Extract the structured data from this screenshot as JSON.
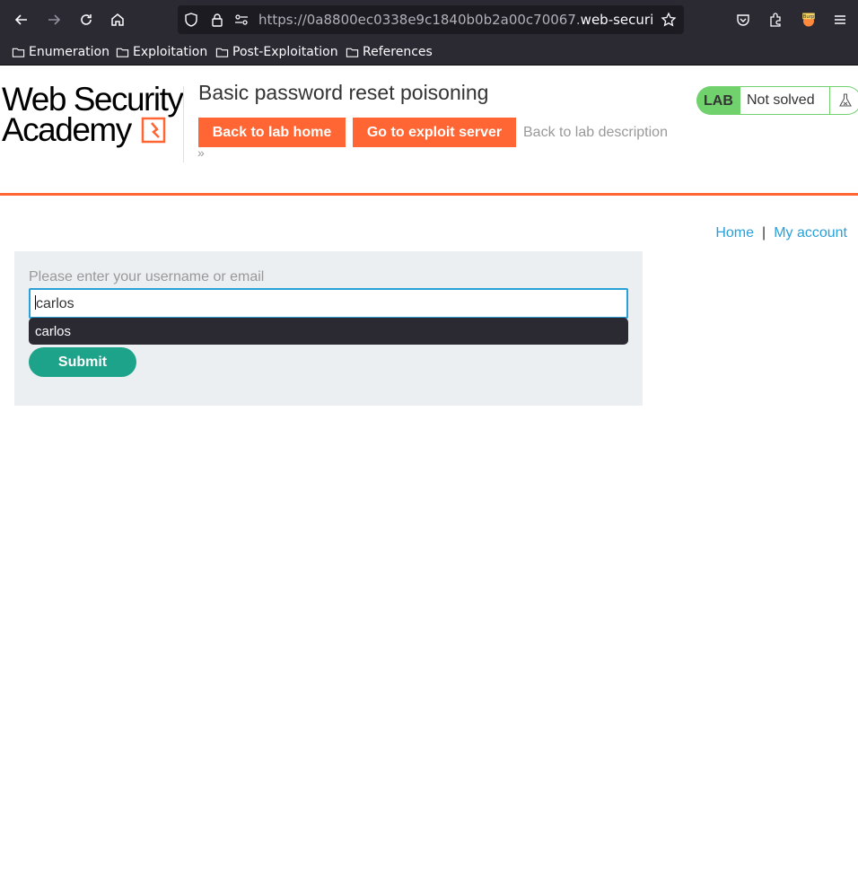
{
  "browser": {
    "url_prefix": "https://0a8800ec0338e9c1840b0b2a00c70067.",
    "url_host": "web-security-ac",
    "bookmarks": [
      {
        "label": "Enumeration"
      },
      {
        "label": "Exploitation"
      },
      {
        "label": "Post-Exploitation"
      },
      {
        "label": "References"
      }
    ],
    "extension_badge": "Burp"
  },
  "header": {
    "logo_line1": "Web Security",
    "logo_line2": "Academy",
    "lab_title": "Basic password reset poisoning",
    "back_to_lab_home": "Back to lab home",
    "go_to_exploit_server": "Go to exploit server",
    "back_to_lab_description": "Back to lab description",
    "chevron": "»",
    "lab_badge": "LAB",
    "lab_status": "Not solved"
  },
  "nav": {
    "home": "Home",
    "separator": "|",
    "my_account": "My account"
  },
  "form": {
    "label": "Please enter your username or email",
    "value": "carlos",
    "autocomplete_option": "carlos",
    "submit": "Submit"
  },
  "colors": {
    "accent_orange": "#ff6633",
    "submit_green": "#1ca38a",
    "link_blue": "#29a0d8",
    "lab_green": "#70d16d"
  }
}
